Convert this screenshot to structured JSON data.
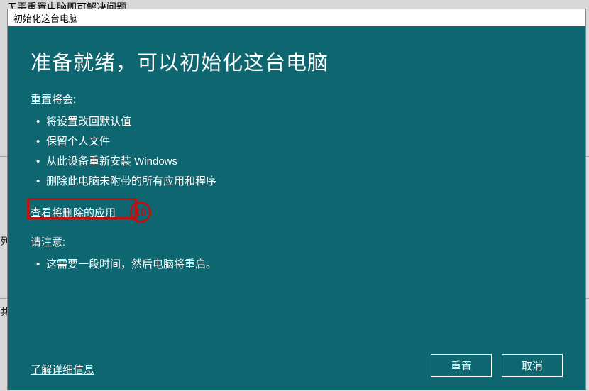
{
  "background": {
    "partial_text_top": "无需重置电脑即可解决问题"
  },
  "window": {
    "title": "初始化这台电脑"
  },
  "content": {
    "heading": "准备就绪，可以初始化这台电脑",
    "reset_label": "重置将会:",
    "bullets": [
      "将设置改回默认值",
      "保留个人文件",
      "从此设备重新安装 Windows",
      "删除此电脑未附带的所有应用和程序"
    ],
    "view_apps_link": "查看将删除的应用",
    "annotation_number": "10",
    "note_label": "请注意:",
    "note_bullets": [
      "这需要一段时间，然后电脑将重启。"
    ],
    "more_info_link": "了解详细信息",
    "buttons": {
      "reset": "重置",
      "cancel": "取消"
    }
  }
}
